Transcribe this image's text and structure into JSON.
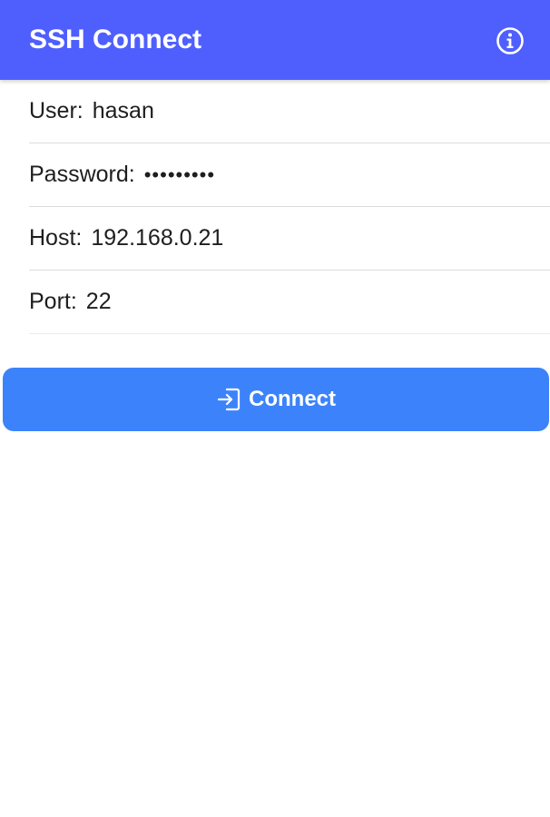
{
  "header": {
    "title": "SSH Connect",
    "info_icon": "info-icon"
  },
  "form": {
    "user": {
      "label": "User:",
      "value": "hasan"
    },
    "password": {
      "label": "Password:",
      "value": "•••••••••"
    },
    "host": {
      "label": "Host:",
      "value": "192.168.0.21"
    },
    "port": {
      "label": "Port:",
      "value": "22"
    }
  },
  "connect_button": {
    "label": "Connect",
    "icon": "login-icon"
  },
  "colors": {
    "header": "#4f5ffe",
    "button": "#3c83fb",
    "text": "#1e1e1e",
    "divider": "#dcdcdc"
  }
}
